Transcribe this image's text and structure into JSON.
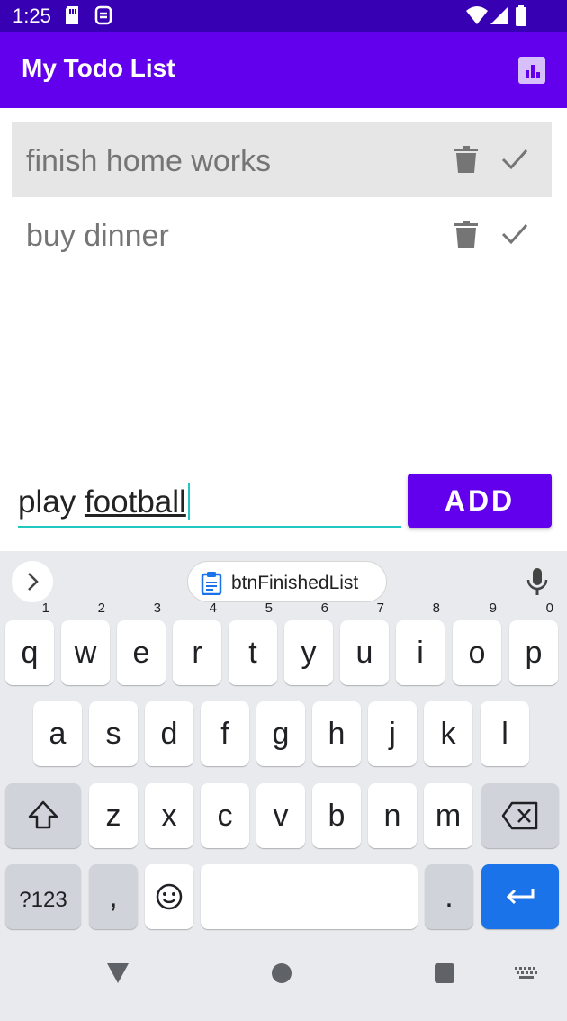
{
  "status_bar": {
    "time": "1:25",
    "background": "#3700b3"
  },
  "app_bar": {
    "title": "My Todo List",
    "background": "#6200ee",
    "action_icon": "bar-chart-icon"
  },
  "todos": [
    {
      "text": "finish home works",
      "selected": true
    },
    {
      "text": "buy dinner",
      "selected": false
    }
  ],
  "input": {
    "value": "play football",
    "prefix": "play ",
    "composing": "football",
    "underline_color": "#1fc8c0"
  },
  "add_button": {
    "label": "ADD"
  },
  "keyboard": {
    "suggestion": "btnFinishedList",
    "row1": [
      {
        "key": "q",
        "hint": "1"
      },
      {
        "key": "w",
        "hint": "2"
      },
      {
        "key": "e",
        "hint": "3"
      },
      {
        "key": "r",
        "hint": "4"
      },
      {
        "key": "t",
        "hint": "5"
      },
      {
        "key": "y",
        "hint": "6"
      },
      {
        "key": "u",
        "hint": "7"
      },
      {
        "key": "i",
        "hint": "8"
      },
      {
        "key": "o",
        "hint": "9"
      },
      {
        "key": "p",
        "hint": "0"
      }
    ],
    "row2": [
      "a",
      "s",
      "d",
      "f",
      "g",
      "h",
      "j",
      "k",
      "l"
    ],
    "row3": [
      "z",
      "x",
      "c",
      "v",
      "b",
      "n",
      "m"
    ],
    "symbols_label": "?123",
    "comma": ",",
    "period": ".",
    "enter_color": "#1a73e8"
  }
}
